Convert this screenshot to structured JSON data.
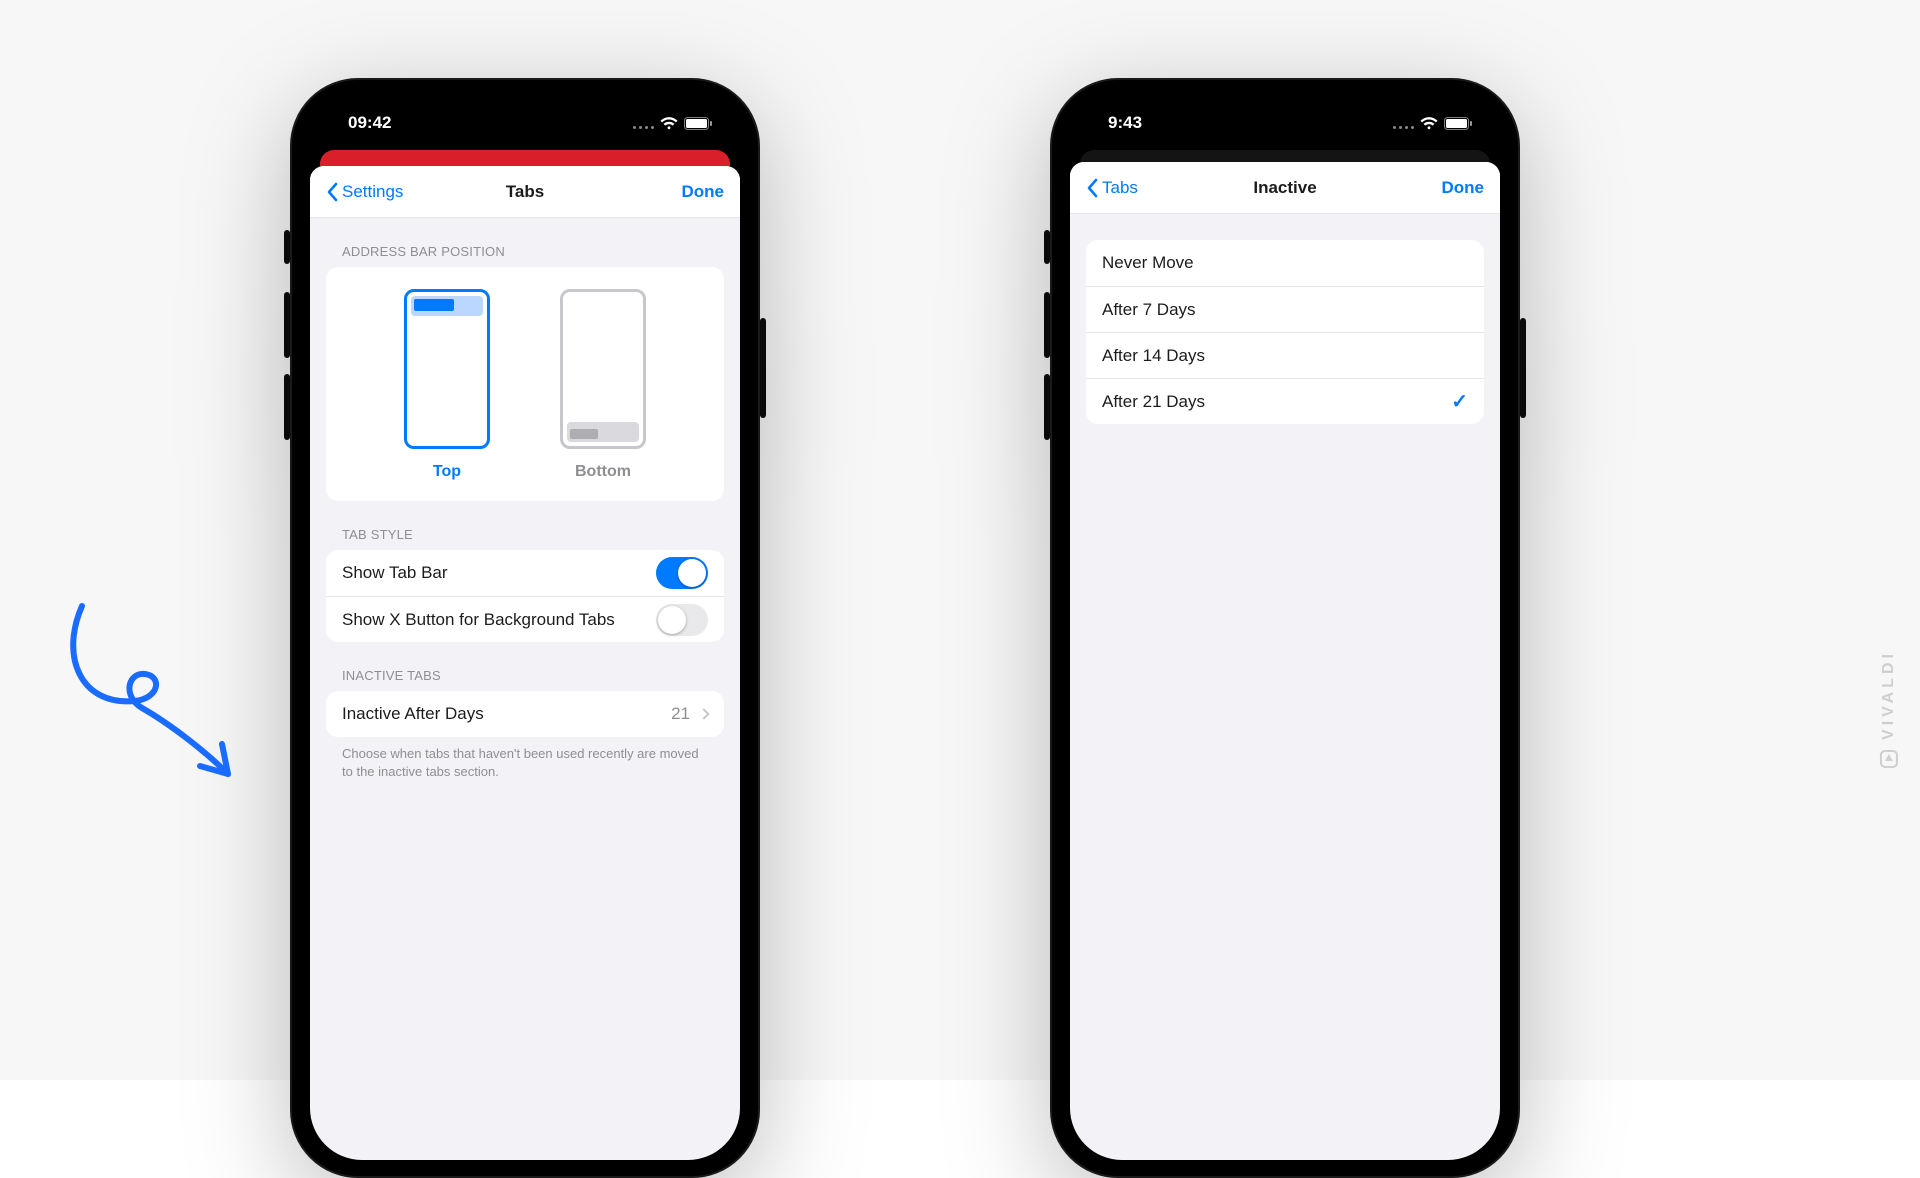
{
  "watermark": "VIVALDI",
  "left_phone": {
    "status_time": "09:42",
    "nav_back": "Settings",
    "nav_title": "Tabs",
    "nav_done": "Done",
    "sections": {
      "address_bar": {
        "header": "ADDRESS BAR POSITION",
        "options": [
          {
            "label": "Top",
            "selected": true
          },
          {
            "label": "Bottom",
            "selected": false
          }
        ]
      },
      "tab_style": {
        "header": "TAB STYLE",
        "rows": [
          {
            "label": "Show Tab Bar",
            "on": true
          },
          {
            "label": "Show X Button for Background Tabs",
            "on": false
          }
        ]
      },
      "inactive": {
        "header": "INACTIVE TABS",
        "row_label": "Inactive After Days",
        "row_value": "21",
        "footer": "Choose when tabs that haven't been used recently are moved to the inactive tabs section."
      }
    }
  },
  "right_phone": {
    "status_time": "9:43",
    "nav_back": "Tabs",
    "nav_title": "Inactive",
    "nav_done": "Done",
    "options": [
      {
        "label": "Never Move",
        "selected": false
      },
      {
        "label": "After 7 Days",
        "selected": false
      },
      {
        "label": "After 14 Days",
        "selected": false
      },
      {
        "label": "After 21 Days",
        "selected": true
      }
    ]
  }
}
